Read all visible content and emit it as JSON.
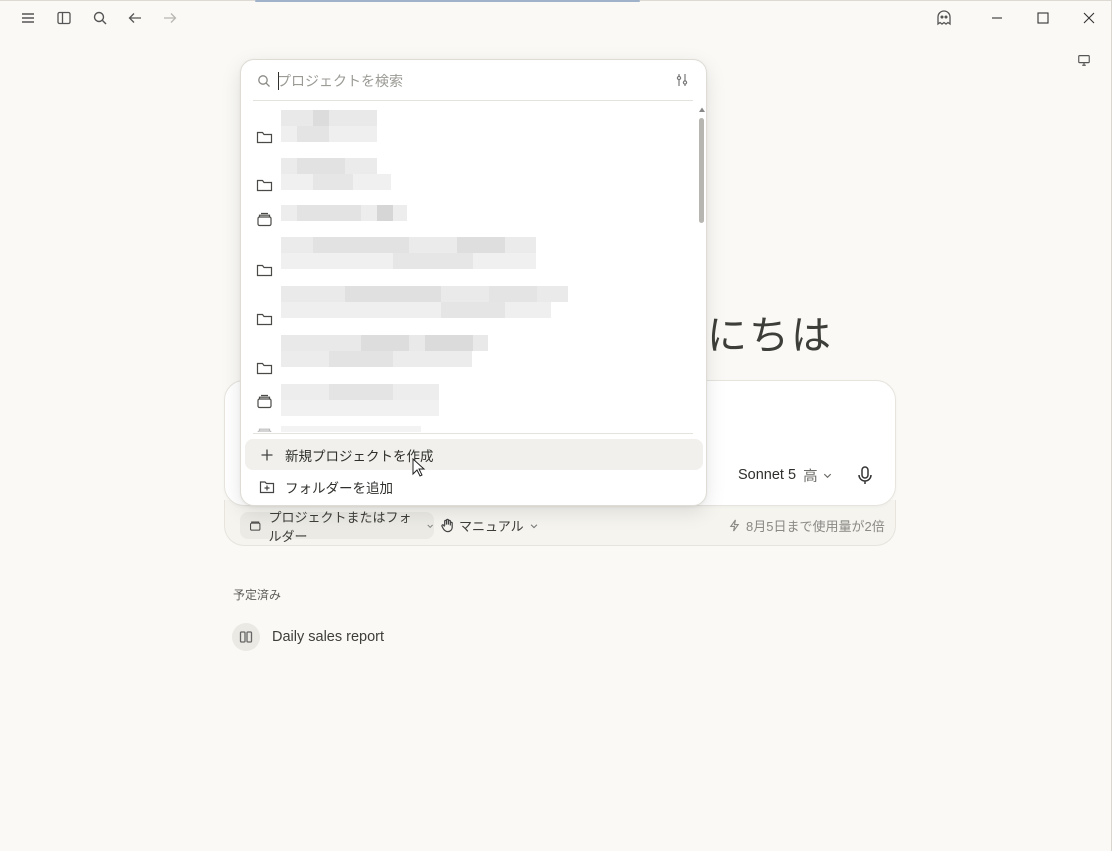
{
  "window": {
    "toolbar_icons": [
      "menu-icon",
      "sidebar-toggle-icon",
      "search-icon",
      "back-arrow-icon",
      "forward-arrow-icon"
    ],
    "right_icons": [
      "ghost-icon",
      "minimize-icon",
      "maximize-icon",
      "close-icon",
      "desktop-icon"
    ]
  },
  "greeting": {
    "text": "にちは"
  },
  "composer": {
    "model": "Sonnet 5",
    "effort": "高",
    "project_chip": "プロジェクトまたはフォルダー",
    "mode_chip": "マニュアル",
    "usage_note": "8月5日まで使用量が2倍"
  },
  "project_dropdown": {
    "search_placeholder": "プロジェクトを検索",
    "items": [
      {
        "icon": "folder-icon"
      },
      {
        "icon": "folder-icon"
      },
      {
        "icon": "project-stack-icon"
      },
      {
        "icon": "folder-icon"
      },
      {
        "icon": "folder-icon"
      },
      {
        "icon": "folder-icon"
      },
      {
        "icon": "project-stack-icon"
      },
      {
        "icon": "project-stack-icon"
      }
    ],
    "actions": {
      "new_project": "新規プロジェクトを作成",
      "add_folder": "フォルダーを追加"
    }
  },
  "scheduled": {
    "heading": "予定済み",
    "items": [
      {
        "label": "Daily sales report",
        "icon": "schedule-icon"
      }
    ]
  },
  "colors": {
    "background": "#faf9f5",
    "surface": "#ffffff",
    "hover": "#f1f0ec",
    "text": "#3d3d3a",
    "muted": "#8a8984"
  }
}
